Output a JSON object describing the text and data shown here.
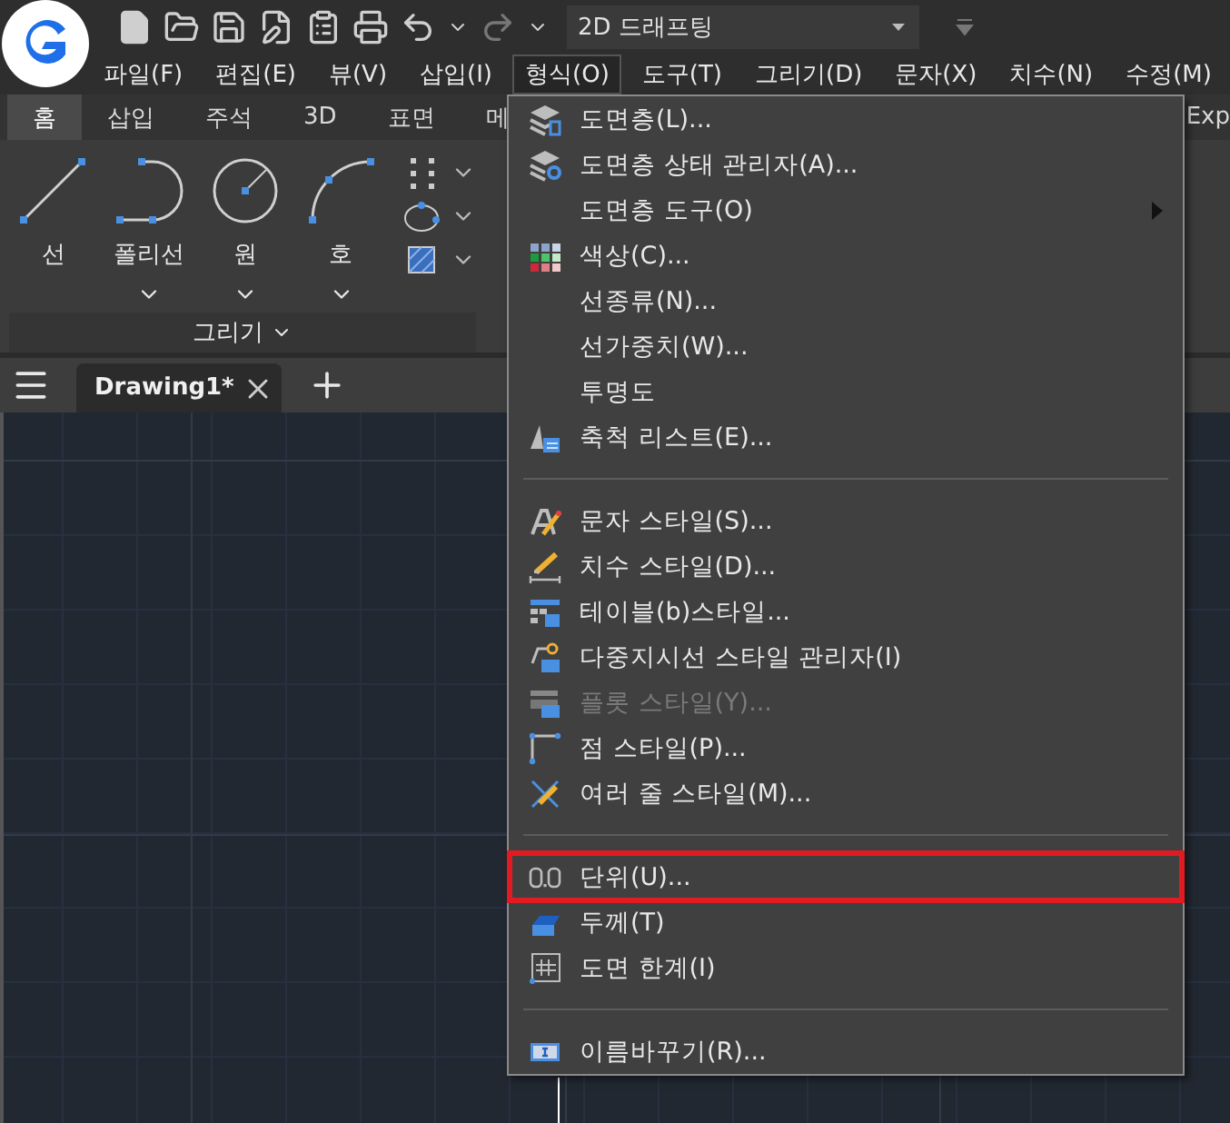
{
  "title_bar": {
    "workspace": "2D 드래프팅"
  },
  "menu_bar": [
    {
      "label": "파일(F)",
      "selected": false
    },
    {
      "label": "편집(E)",
      "selected": false
    },
    {
      "label": "뷰(V)",
      "selected": false
    },
    {
      "label": "삽입(I)",
      "selected": false
    },
    {
      "label": "형식(O)",
      "selected": true
    },
    {
      "label": "도구(T)",
      "selected": false
    },
    {
      "label": "그리기(D)",
      "selected": false
    },
    {
      "label": "문자(X)",
      "selected": false
    },
    {
      "label": "치수(N)",
      "selected": false
    },
    {
      "label": "수정(M)",
      "selected": false
    }
  ],
  "ribbon_tabs": [
    {
      "label": "홈",
      "selected": true
    },
    {
      "label": "삽입",
      "selected": false
    },
    {
      "label": "주석",
      "selected": false
    },
    {
      "label": "3D",
      "selected": false
    },
    {
      "label": "표면",
      "selected": false
    },
    {
      "label": "메",
      "selected": false
    },
    {
      "label": "Exp",
      "selected": false
    }
  ],
  "ribbon": {
    "tools": [
      {
        "label": "선",
        "dropdown": false
      },
      {
        "label": "폴리선",
        "dropdown": true
      },
      {
        "label": "원",
        "dropdown": true
      },
      {
        "label": "호",
        "dropdown": true
      }
    ],
    "panel_title": "그리기"
  },
  "document_tabs": [
    {
      "label": "Drawing1*",
      "selected": true
    }
  ],
  "format_menu": [
    {
      "kind": "item",
      "label": "도면층(L)...",
      "disabled": false,
      "submenu": false,
      "highlighted": false
    },
    {
      "kind": "item",
      "label": "도면층 상태 관리자(A)...",
      "disabled": false,
      "submenu": false,
      "highlighted": false
    },
    {
      "kind": "item",
      "label": "도면층 도구(O)",
      "disabled": false,
      "submenu": true,
      "highlighted": false
    },
    {
      "kind": "item",
      "label": "색상(C)...",
      "disabled": false,
      "submenu": false,
      "highlighted": false
    },
    {
      "kind": "item",
      "label": "선종류(N)...",
      "disabled": false,
      "submenu": false,
      "highlighted": false
    },
    {
      "kind": "item",
      "label": "선가중치(W)...",
      "disabled": false,
      "submenu": false,
      "highlighted": false
    },
    {
      "kind": "item",
      "label": "투명도",
      "disabled": false,
      "submenu": false,
      "highlighted": false
    },
    {
      "kind": "item",
      "label": "축척 리스트(E)...",
      "disabled": false,
      "submenu": false,
      "highlighted": false
    },
    {
      "kind": "separator"
    },
    {
      "kind": "item",
      "label": "문자 스타일(S)...",
      "disabled": false,
      "submenu": false,
      "highlighted": false
    },
    {
      "kind": "item",
      "label": "치수 스타일(D)...",
      "disabled": false,
      "submenu": false,
      "highlighted": false
    },
    {
      "kind": "item",
      "label": "테이블(b)스타일...",
      "disabled": false,
      "submenu": false,
      "highlighted": false
    },
    {
      "kind": "item",
      "label": "다중지시선 스타일 관리자(I)",
      "disabled": false,
      "submenu": false,
      "highlighted": false
    },
    {
      "kind": "item",
      "label": "플롯 스타일(Y)...",
      "disabled": true,
      "submenu": false,
      "highlighted": false
    },
    {
      "kind": "item",
      "label": "점 스타일(P)...",
      "disabled": false,
      "submenu": false,
      "highlighted": false
    },
    {
      "kind": "item",
      "label": "여러 줄 스타일(M)...",
      "disabled": false,
      "submenu": false,
      "highlighted": false
    },
    {
      "kind": "separator"
    },
    {
      "kind": "item",
      "label": "단위(U)...",
      "disabled": false,
      "submenu": false,
      "highlighted": true
    },
    {
      "kind": "item",
      "label": "두께(T)",
      "disabled": false,
      "submenu": false,
      "highlighted": false
    },
    {
      "kind": "item",
      "label": "도면 한계(I)",
      "disabled": false,
      "submenu": false,
      "highlighted": false
    },
    {
      "kind": "separator"
    },
    {
      "kind": "item",
      "label": "이름바꾸기(R)...",
      "disabled": false,
      "submenu": false,
      "highlighted": false
    }
  ]
}
